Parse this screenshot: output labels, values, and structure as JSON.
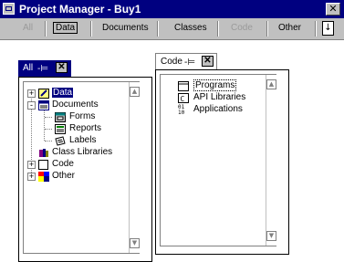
{
  "window": {
    "title": "Project Manager - Buy1",
    "close_glyph": "✕"
  },
  "tabs": [
    {
      "label": "All",
      "state": "disabled"
    },
    {
      "label": "Data",
      "state": "selected"
    },
    {
      "label": "Documents",
      "state": "normal"
    },
    {
      "label": "Classes",
      "state": "normal"
    },
    {
      "label": "Code",
      "state": "disabled"
    },
    {
      "label": "Other",
      "state": "normal"
    }
  ],
  "dropdown_glyph": "↓",
  "all_panel": {
    "title": "All",
    "tree": [
      {
        "label": "Data",
        "icon": "data-icon",
        "expander": "+",
        "selected": true
      },
      {
        "label": "Documents",
        "icon": "documents-icon",
        "expander": "-"
      },
      {
        "label": "Forms",
        "icon": "forms-icon"
      },
      {
        "label": "Reports",
        "icon": "reports-icon"
      },
      {
        "label": "Labels",
        "icon": "labels-icon"
      },
      {
        "label": "Class Libraries",
        "icon": "class-libraries-icon"
      },
      {
        "label": "Code",
        "icon": "code-icon",
        "expander": "+"
      },
      {
        "label": "Other",
        "icon": "other-icon",
        "expander": "+"
      }
    ]
  },
  "code_panel": {
    "title": "Code",
    "tree": [
      {
        "label": "Programs",
        "icon": "programs-icon",
        "focused": true
      },
      {
        "label": "API Libraries",
        "icon": "api-libraries-icon"
      },
      {
        "label": "Applications",
        "icon": "applications-icon"
      }
    ]
  },
  "colors": {
    "titlebar": "#000080",
    "panel_header_active": "#000080",
    "chrome": "#c0c0c0"
  }
}
